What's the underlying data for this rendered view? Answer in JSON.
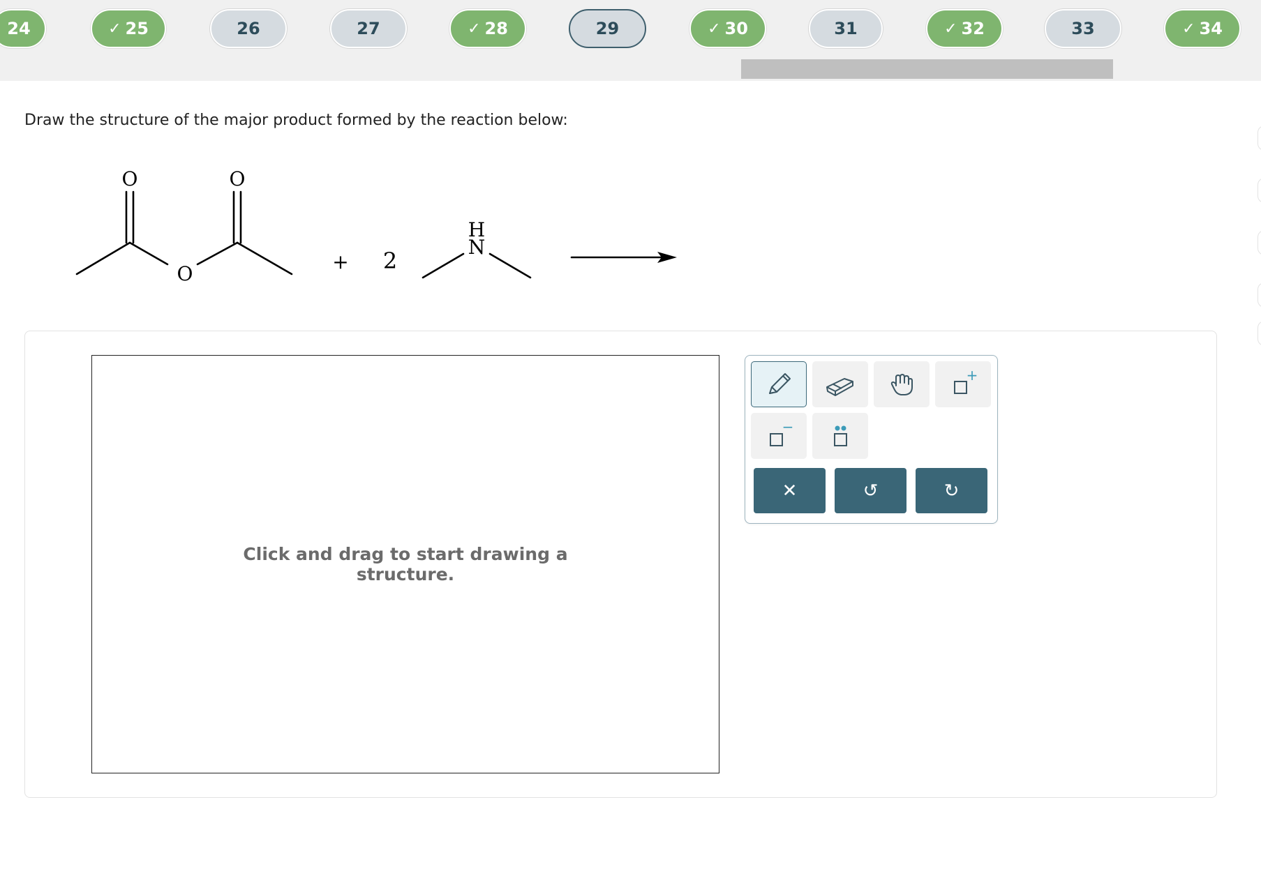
{
  "question_nav": {
    "items": [
      {
        "label": "24",
        "state": "done",
        "check": ""
      },
      {
        "label": "25",
        "state": "done",
        "check": "✓"
      },
      {
        "label": "26",
        "state": "todo",
        "check": ""
      },
      {
        "label": "27",
        "state": "todo",
        "check": ""
      },
      {
        "label": "28",
        "state": "done",
        "check": "✓"
      },
      {
        "label": "29",
        "state": "current",
        "check": ""
      },
      {
        "label": "30",
        "state": "done",
        "check": "✓"
      },
      {
        "label": "31",
        "state": "todo",
        "check": ""
      },
      {
        "label": "32",
        "state": "done",
        "check": "✓"
      },
      {
        "label": "33",
        "state": "todo",
        "check": ""
      },
      {
        "label": "34",
        "state": "done",
        "check": "✓"
      }
    ]
  },
  "question": {
    "prompt": "Draw the structure of the major product formed by the reaction below:",
    "reaction": {
      "reactant1_atoms": {
        "carbonyl_o_left": "O",
        "carbonyl_o_right": "O",
        "bridge_o": "O"
      },
      "plus": "+",
      "coefficient": "2",
      "reactant2_atoms": {
        "h": "H",
        "n": "N"
      }
    }
  },
  "editor": {
    "canvas_hint": "Click and drag to start drawing a structure.",
    "tools": [
      {
        "name": "pencil-icon",
        "active": true
      },
      {
        "name": "eraser-icon",
        "active": false
      },
      {
        "name": "hand-icon",
        "active": false
      },
      {
        "name": "add-charge-icon",
        "active": false
      },
      {
        "name": "remove-charge-icon",
        "active": false
      },
      {
        "name": "lone-pair-icon",
        "active": false
      }
    ],
    "tool_glyphs": {
      "plus": "+",
      "minus": "−"
    },
    "actions": [
      {
        "name": "clear-icon",
        "glyph": "✕"
      },
      {
        "name": "undo-icon",
        "glyph": "↺"
      },
      {
        "name": "redo-icon",
        "glyph": "↻"
      }
    ]
  },
  "colors": {
    "done": "#7fb56f",
    "todo": "#d5dbe0",
    "current_border": "#3f5f6d",
    "action_button": "#3a6677",
    "active_tool_bg": "#e6f2f6"
  }
}
